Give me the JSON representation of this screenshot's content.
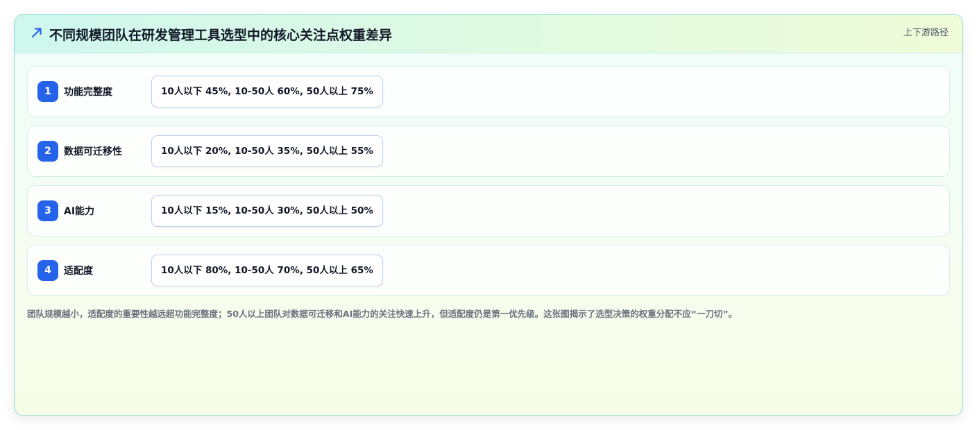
{
  "header": {
    "title": "不同规模团队在研发管理工具选型中的核心关注点权重差异",
    "badge": "上下游路径",
    "icon": "trend-arrow-icon",
    "accent_color": "#2563eb"
  },
  "rows": [
    {
      "num": "1",
      "label": "功能完整度",
      "value": "10人以下 45%, 10-50人 60%, 50人以上 75%"
    },
    {
      "num": "2",
      "label": "数据可迁移性",
      "value": "10人以下 20%, 10-50人 35%, 50人以上 55%"
    },
    {
      "num": "3",
      "label": "AI能力",
      "value": "10人以下 15%, 10-50人 30%, 50人以上 50%"
    },
    {
      "num": "4",
      "label": "适配度",
      "value": "10人以下 80%, 10-50人 70%, 50人以上 65%"
    }
  ],
  "footnote": "团队规模越小，适配度的重要性越远超功能完整度；50人以上团队对数据可迁移和AI能力的关注快速上升，但适配度仍是第一优先级。这张图揭示了选型决策的权重分配不应“一刀切”。"
}
